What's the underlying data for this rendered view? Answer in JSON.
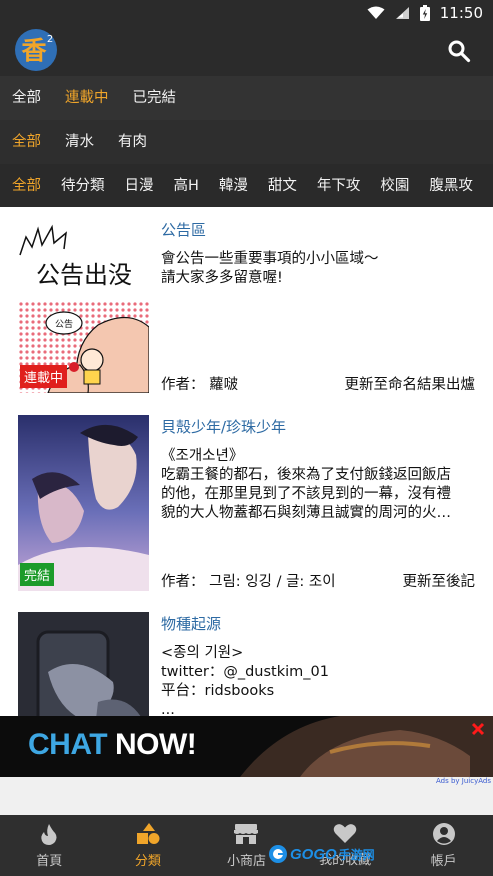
{
  "status_bar": {
    "time": "11:50"
  },
  "app_bar": {
    "logo_text": "香",
    "logo_superscript": "2"
  },
  "filters": {
    "status": [
      {
        "label": "全部",
        "active": false
      },
      {
        "label": "連載中",
        "active": true
      },
      {
        "label": "已完結",
        "active": false
      }
    ],
    "rating": [
      {
        "label": "全部",
        "active": true
      },
      {
        "label": "清水",
        "active": false
      },
      {
        "label": "有肉",
        "active": false
      }
    ],
    "genre": [
      {
        "label": "全部",
        "active": true
      },
      {
        "label": "待分類",
        "active": false
      },
      {
        "label": "日漫",
        "active": false
      },
      {
        "label": "高H",
        "active": false
      },
      {
        "label": "韓漫",
        "active": false
      },
      {
        "label": "甜文",
        "active": false
      },
      {
        "label": "年下攻",
        "active": false
      },
      {
        "label": "校園",
        "active": false
      },
      {
        "label": "腹黑攻",
        "active": false
      }
    ]
  },
  "comics": [
    {
      "title": "公告區",
      "description": [
        "會公告一些重要事項的小小區域～",
        "請大家多多留意喔!"
      ],
      "author": "作者： 蘿啵",
      "update": "更新至命名結果出爐",
      "badge": "連載中",
      "thumb_text": "公告出没",
      "thumb_bubble": "公告"
    },
    {
      "title": "貝殼少年/珍珠少年",
      "description": [
        "《조개소년》",
        "吃霸王餐的都石，後來為了支付飯錢返回飯店",
        "的他，在那里見到了不該見到的一幕，沒有禮",
        "貌的大人物蓋都石與刻薄且誠實的周河的火…"
      ],
      "author": "作者： 그림: 잉깅 / 글: 조이",
      "update": "更新至後記",
      "badge": "完結"
    },
    {
      "title": "物種起源",
      "description": [
        "<종의 기원>",
        "twitter：@_dustkim_01",
        "平台：ridsbooks",
        "..."
      ]
    }
  ],
  "ad": {
    "chat": "CHAT",
    "now": "NOW!",
    "credit": "Ads by JuicyAds"
  },
  "bottom_nav": [
    {
      "label": "首頁",
      "icon": "flame-icon",
      "active": false
    },
    {
      "label": "分類",
      "icon": "shapes-icon",
      "active": true
    },
    {
      "label": "小商店",
      "icon": "store-icon",
      "active": false
    },
    {
      "label": "我的收藏",
      "icon": "heart-icon",
      "active": false
    },
    {
      "label": "帳戶",
      "icon": "user-icon",
      "active": false
    }
  ],
  "watermark": {
    "brand": "GOGO",
    "suffix": "手游网"
  },
  "colors": {
    "accent": "#f0a52a",
    "link": "#2d6aa3",
    "bar": "#2b2b2b"
  }
}
